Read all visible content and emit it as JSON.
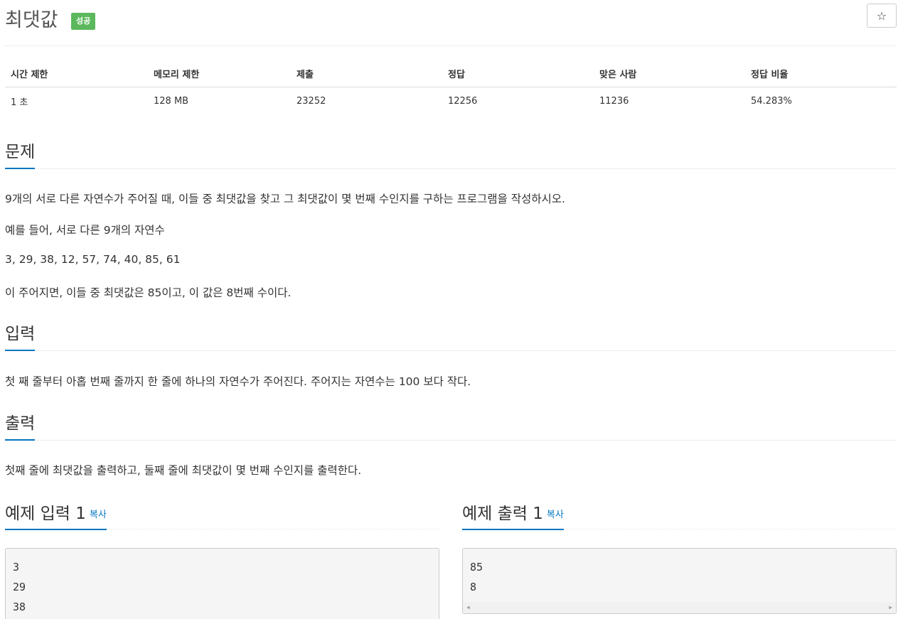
{
  "header": {
    "title": "최댓값",
    "badge": "성공",
    "star_icon": "☆"
  },
  "info_table": {
    "columns": [
      "시간 제한",
      "메모리 제한",
      "제출",
      "정답",
      "맞은 사람",
      "정답 비율"
    ],
    "values": [
      "1 초",
      "128 MB",
      "23252",
      "12256",
      "11236",
      "54.283%"
    ]
  },
  "problem": {
    "title": "문제",
    "paragraphs": [
      "9개의 서로 다른 자연수가 주어질 때, 이들 중 최댓값을 찾고 그 최댓값이 몇 번째 수인지를 구하는 프로그램을 작성하시오.",
      "예를 들어, 서로 다른 9개의 자연수",
      "3, 29, 38, 12, 57, 74, 40, 85, 61",
      "이 주어지면, 이들 중 최댓값은 85이고, 이 값은 8번째 수이다."
    ]
  },
  "input_section": {
    "title": "입력",
    "text": "첫 째 줄부터 아홉 번째 줄까지 한 줄에 하나의 자연수가 주어진다. 주어지는 자연수는 100 보다 작다."
  },
  "output_section": {
    "title": "출력",
    "text": "첫째 줄에 최댓값을 출력하고, 둘째 줄에 최댓값이 몇 번째 수인지를 출력한다."
  },
  "sample_input": {
    "title": "예제 입력 1",
    "copy_label": "복사",
    "lines": [
      "3",
      "29",
      "38"
    ]
  },
  "sample_output": {
    "title": "예제 출력 1",
    "copy_label": "복사",
    "lines": [
      "85",
      "8"
    ]
  },
  "colors": {
    "accent": "#0076c0",
    "success_badge": "#5cb85c"
  }
}
